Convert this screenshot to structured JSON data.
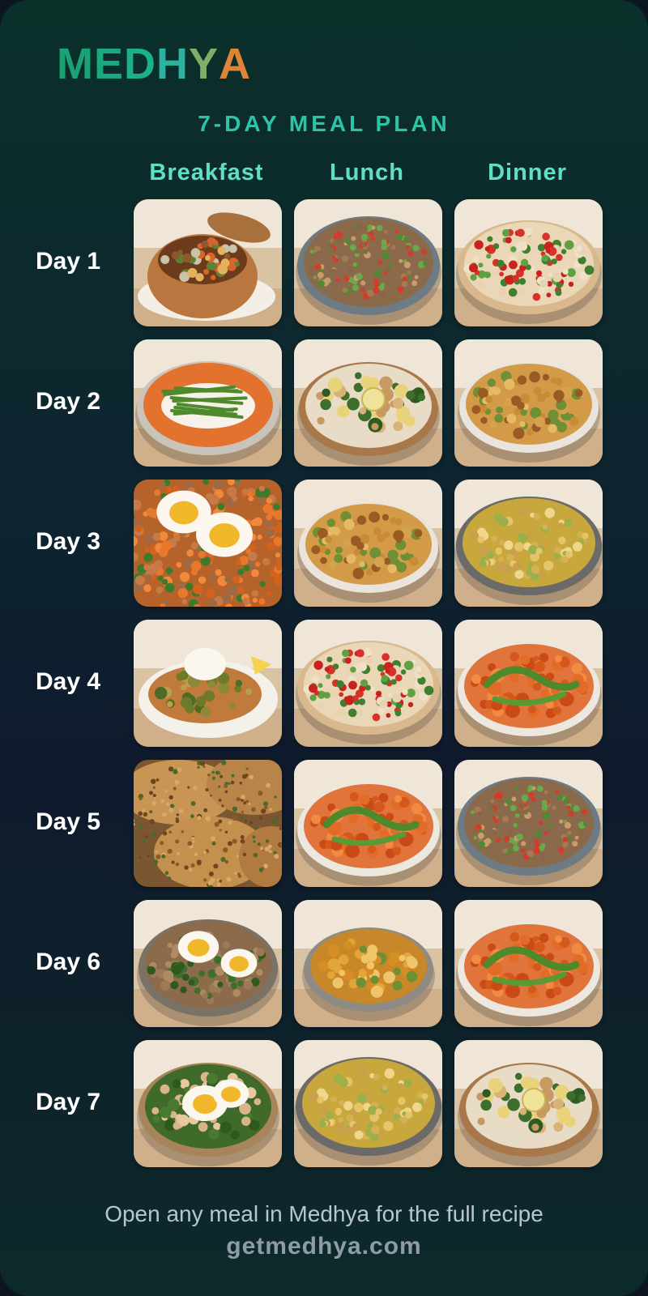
{
  "brand": {
    "logo_letters": [
      {
        "ch": "M",
        "color": "#1aa276"
      },
      {
        "ch": "E",
        "color": "#1aa87e"
      },
      {
        "ch": "D",
        "color": "#1bb08c"
      },
      {
        "ch": "H",
        "color": "#2bb3a0"
      },
      {
        "ch": "Y",
        "color": "#7fae6a"
      },
      {
        "ch": "A",
        "color": "#e0843a"
      }
    ]
  },
  "plan": {
    "title": "7-DAY MEAL PLAN",
    "columns": [
      "Breakfast",
      "Lunch",
      "Dinner"
    ],
    "days": [
      {
        "label": "Day 1",
        "meals": [
          "bread-bowl-stew",
          "quinoa-veggie-bowl",
          "white-bean-tomato-salad"
        ]
      },
      {
        "label": "Day 2",
        "meals": [
          "asparagus-yogurt-bowl",
          "chicken-lemon-rice",
          "roasted-chickpea-potato"
        ]
      },
      {
        "label": "Day 3",
        "meals": [
          "egg-sweet-potato-hash",
          "roasted-chickpea-potato",
          "chickpea-curry"
        ]
      },
      {
        "label": "Day 4",
        "meals": [
          "poached-egg-toast",
          "white-bean-tomato-salad",
          "pesto-sweet-potato"
        ]
      },
      {
        "label": "Day 5",
        "meals": [
          "savory-flatbread",
          "pesto-sweet-potato",
          "quinoa-veggie-bowl"
        ]
      },
      {
        "label": "Day 6",
        "meals": [
          "egg-greens-grain-bowl",
          "chickpea-stew-bowl",
          "pesto-sweet-potato"
        ]
      },
      {
        "label": "Day 7",
        "meals": [
          "egg-greens-chicken-bowl",
          "chickpea-curry",
          "chicken-lemon-rice"
        ]
      }
    ]
  },
  "footer": {
    "text": "Open any meal in Medhya for the full recipe",
    "link": "getmedhya.com"
  },
  "colors": {
    "accent": "#2bc4a6",
    "column_heading": "#5fe0c6"
  }
}
